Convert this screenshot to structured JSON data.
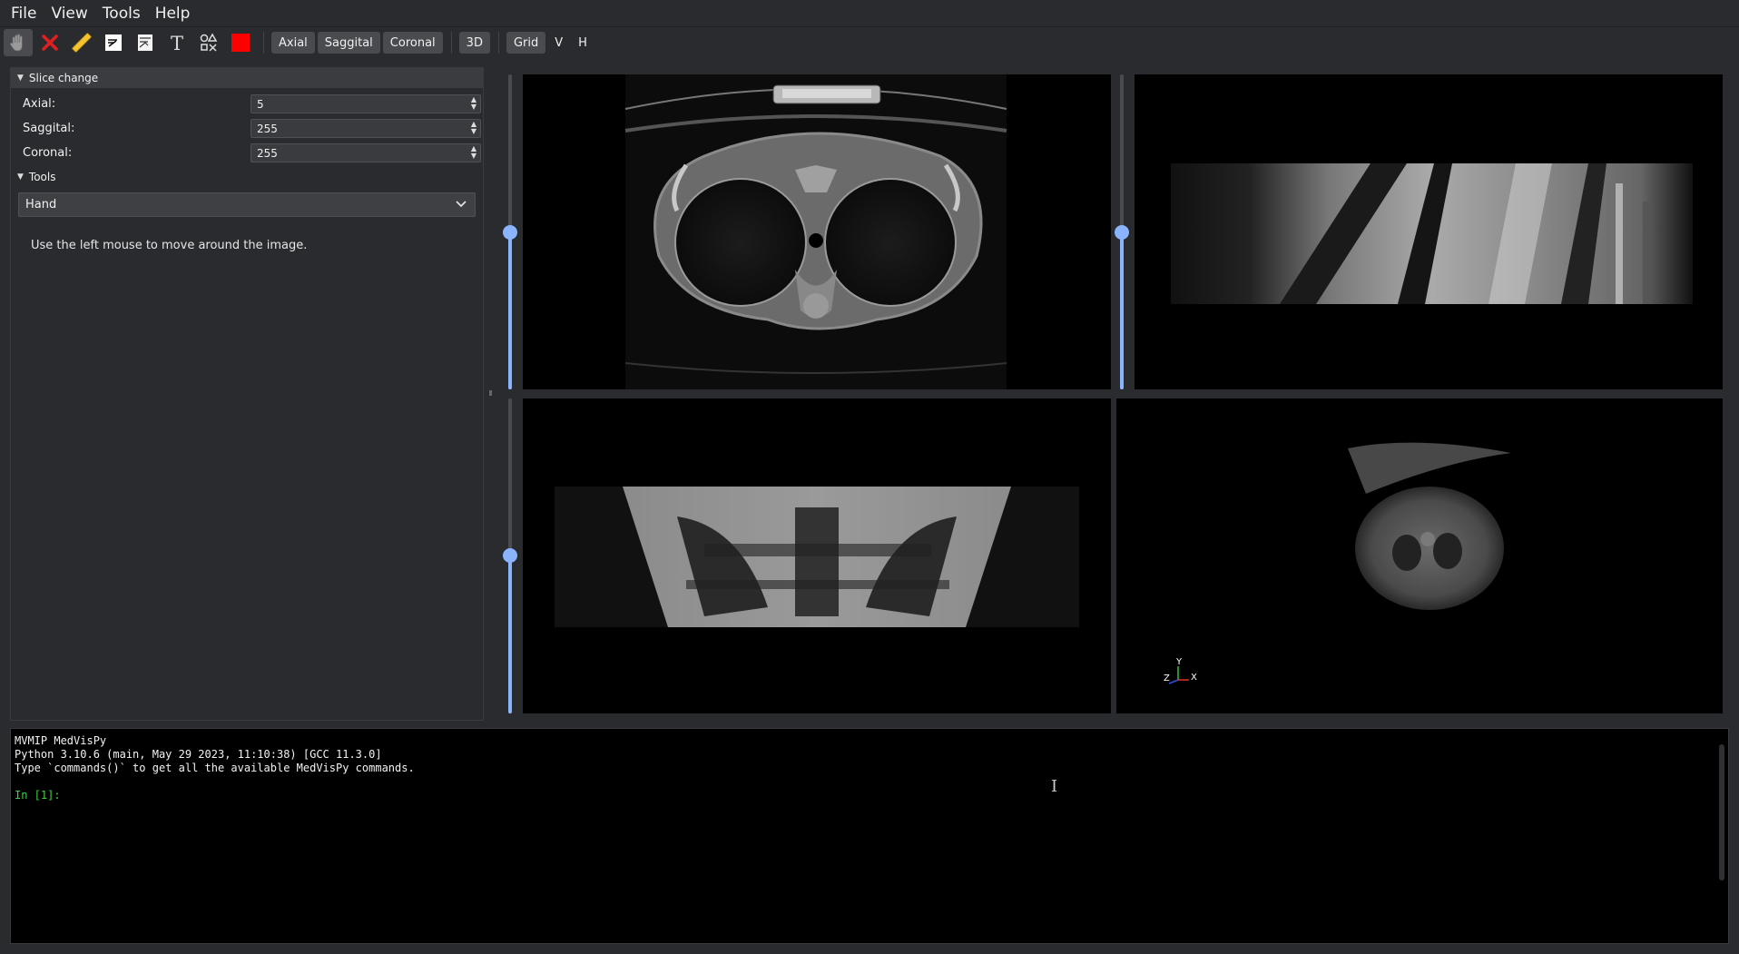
{
  "menubar": {
    "items": [
      "File",
      "View",
      "Tools",
      "Help"
    ]
  },
  "toolbar": {
    "tools": [
      {
        "name": "hand-tool-icon"
      },
      {
        "name": "delete-icon"
      },
      {
        "name": "ruler-icon"
      },
      {
        "name": "paint-icon"
      },
      {
        "name": "annotate-icon"
      },
      {
        "name": "text-icon"
      },
      {
        "name": "shapes-icon"
      },
      {
        "name": "color-swatch-icon",
        "color": "#ff0000"
      }
    ],
    "view_buttons": [
      "Axial",
      "Saggital",
      "Coronal"
    ],
    "three_d": "3D",
    "grid": "Grid",
    "v": "V",
    "h": "H"
  },
  "left_panel": {
    "slice_section": "Slice change",
    "fields": [
      {
        "label": "Axial:",
        "value": "5"
      },
      {
        "label": "Saggital:",
        "value": "255"
      },
      {
        "label": "Coronal:",
        "value": "255"
      }
    ],
    "tools_section": "Tools",
    "tool_select": "Hand",
    "help_text": "Use the left mouse to move around the image."
  },
  "viewers": {
    "slider_color": "#8bb4ff",
    "axes_labels": {
      "y": "Y",
      "z": "Z",
      "x": "X"
    }
  },
  "console": {
    "lines": [
      "MVMIP MedVisPy",
      "Python 3.10.6 (main, May 29 2023, 11:10:38) [GCC 11.3.0]",
      "Type `commands()` to get all the available MedVisPy commands."
    ],
    "prompt": "In [1]:"
  }
}
